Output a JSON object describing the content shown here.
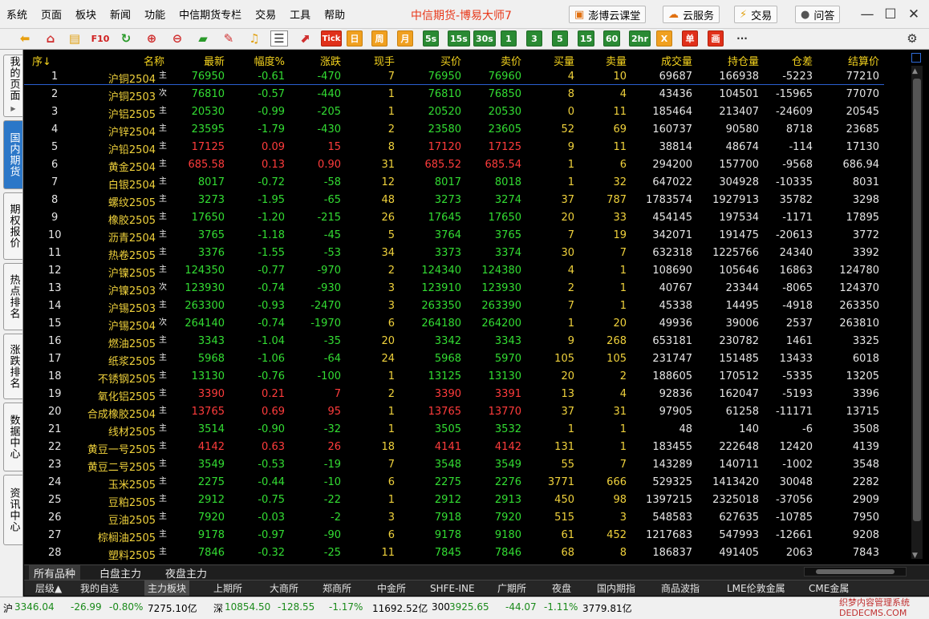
{
  "menu": [
    "系统",
    "页面",
    "板块",
    "新闻",
    "功能",
    "中信期货专栏",
    "交易",
    "工具",
    "帮助"
  ],
  "app_title": "中信期货-博易大师7",
  "top_buttons": [
    {
      "label": "澎博云课堂",
      "icon": "book-icon"
    },
    {
      "label": "云服务",
      "icon": "cloud-icon"
    },
    {
      "label": "交易",
      "icon": "lightning-icon"
    },
    {
      "label": "问答",
      "icon": "chat-icon"
    }
  ],
  "toolbar": {
    "f10": "F10",
    "tick": "Tick",
    "periods": [
      "日",
      "周",
      "月",
      "5s",
      "15s",
      "30s",
      "1",
      "3",
      "5",
      "15",
      "60",
      "2hr",
      "X",
      "单",
      "画"
    ],
    "more": "···"
  },
  "left_tabs": [
    "我的页面",
    "国内期货",
    "期权报价",
    "热点排名",
    "涨跌排名",
    "数据中心",
    "资讯中心"
  ],
  "headers": [
    "序↓",
    "名称",
    "最新",
    "幅度%",
    "涨跌",
    "现手",
    "买价",
    "卖价",
    "买量",
    "卖量",
    "成交量",
    "持仓量",
    "仓差",
    "结算价"
  ],
  "rows": [
    [
      "1",
      "沪铜2504",
      "主",
      "76950",
      "-0.61",
      "-470",
      "7",
      "76950",
      "76960",
      "4",
      "10",
      "69687",
      "166938",
      "-5223",
      "77210",
      "d"
    ],
    [
      "2",
      "沪铜2503",
      "次",
      "76810",
      "-0.57",
      "-440",
      "1",
      "76810",
      "76850",
      "8",
      "4",
      "43436",
      "104501",
      "-15965",
      "77070",
      "d"
    ],
    [
      "3",
      "沪铝2505",
      "主",
      "20530",
      "-0.99",
      "-205",
      "1",
      "20520",
      "20530",
      "0",
      "11",
      "185464",
      "213407",
      "-24609",
      "20545",
      "d"
    ],
    [
      "4",
      "沪锌2504",
      "主",
      "23595",
      "-1.79",
      "-430",
      "2",
      "23580",
      "23605",
      "52",
      "69",
      "160737",
      "90580",
      "8718",
      "23685",
      "d"
    ],
    [
      "5",
      "沪铅2504",
      "主",
      "17125",
      "0.09",
      "15",
      "8",
      "17120",
      "17125",
      "9",
      "11",
      "38814",
      "48674",
      "-114",
      "17130",
      "u"
    ],
    [
      "6",
      "黄金2504",
      "主",
      "685.58",
      "0.13",
      "0.90",
      "31",
      "685.52",
      "685.54",
      "1",
      "6",
      "294200",
      "157700",
      "-9568",
      "686.94",
      "u"
    ],
    [
      "7",
      "白银2504",
      "主",
      "8017",
      "-0.72",
      "-58",
      "12",
      "8017",
      "8018",
      "1",
      "32",
      "647022",
      "304928",
      "-10335",
      "8031",
      "d"
    ],
    [
      "8",
      "螺纹2505",
      "主",
      "3273",
      "-1.95",
      "-65",
      "48",
      "3273",
      "3274",
      "37",
      "787",
      "1783574",
      "1927913",
      "35782",
      "3298",
      "d"
    ],
    [
      "9",
      "橡胶2505",
      "主",
      "17650",
      "-1.20",
      "-215",
      "26",
      "17645",
      "17650",
      "20",
      "33",
      "454145",
      "197534",
      "-1171",
      "17895",
      "d"
    ],
    [
      "10",
      "沥青2504",
      "主",
      "3765",
      "-1.18",
      "-45",
      "5",
      "3764",
      "3765",
      "7",
      "19",
      "342071",
      "191475",
      "-20613",
      "3772",
      "d"
    ],
    [
      "11",
      "热卷2505",
      "主",
      "3376",
      "-1.55",
      "-53",
      "34",
      "3373",
      "3374",
      "30",
      "7",
      "632318",
      "1225766",
      "24340",
      "3392",
      "d"
    ],
    [
      "12",
      "沪镍2505",
      "主",
      "124350",
      "-0.77",
      "-970",
      "2",
      "124340",
      "124380",
      "4",
      "1",
      "108690",
      "105646",
      "16863",
      "124780",
      "d"
    ],
    [
      "13",
      "沪镍2503",
      "次",
      "123930",
      "-0.74",
      "-930",
      "3",
      "123910",
      "123930",
      "2",
      "1",
      "40767",
      "23344",
      "-8065",
      "124370",
      "d"
    ],
    [
      "14",
      "沪锡2503",
      "主",
      "263300",
      "-0.93",
      "-2470",
      "3",
      "263350",
      "263390",
      "7",
      "1",
      "45338",
      "14495",
      "-4918",
      "263350",
      "d"
    ],
    [
      "15",
      "沪锡2504",
      "次",
      "264140",
      "-0.74",
      "-1970",
      "6",
      "264180",
      "264200",
      "1",
      "20",
      "49936",
      "39006",
      "2537",
      "263810",
      "d"
    ],
    [
      "16",
      "燃油2505",
      "主",
      "3343",
      "-1.04",
      "-35",
      "20",
      "3342",
      "3343",
      "9",
      "268",
      "653181",
      "230782",
      "1461",
      "3325",
      "d"
    ],
    [
      "17",
      "纸浆2505",
      "主",
      "5968",
      "-1.06",
      "-64",
      "24",
      "5968",
      "5970",
      "105",
      "105",
      "231747",
      "151485",
      "13433",
      "6018",
      "d"
    ],
    [
      "18",
      "不锈钢2505",
      "主",
      "13130",
      "-0.76",
      "-100",
      "1",
      "13125",
      "13130",
      "20",
      "2",
      "188605",
      "170512",
      "-5335",
      "13205",
      "d"
    ],
    [
      "19",
      "氧化铝2505",
      "主",
      "3390",
      "0.21",
      "7",
      "2",
      "3390",
      "3391",
      "13",
      "4",
      "92836",
      "162047",
      "-5193",
      "3396",
      "u"
    ],
    [
      "20",
      "合成橡胶2504",
      "主",
      "13765",
      "0.69",
      "95",
      "1",
      "13765",
      "13770",
      "37",
      "31",
      "97905",
      "61258",
      "-11171",
      "13715",
      "u"
    ],
    [
      "21",
      "线材2505",
      "主",
      "3514",
      "-0.90",
      "-32",
      "1",
      "3505",
      "3532",
      "1",
      "1",
      "48",
      "140",
      "-6",
      "3508",
      "d"
    ],
    [
      "22",
      "黄豆一号2505",
      "主",
      "4142",
      "0.63",
      "26",
      "18",
      "4141",
      "4142",
      "131",
      "1",
      "183455",
      "222648",
      "12420",
      "4139",
      "u"
    ],
    [
      "23",
      "黄豆二号2505",
      "主",
      "3549",
      "-0.53",
      "-19",
      "7",
      "3548",
      "3549",
      "55",
      "7",
      "143289",
      "140711",
      "-1002",
      "3548",
      "d"
    ],
    [
      "24",
      "玉米2505",
      "主",
      "2275",
      "-0.44",
      "-10",
      "6",
      "2275",
      "2276",
      "3771",
      "666",
      "529325",
      "1413420",
      "30048",
      "2282",
      "d"
    ],
    [
      "25",
      "豆粕2505",
      "主",
      "2912",
      "-0.75",
      "-22",
      "1",
      "2912",
      "2913",
      "450",
      "98",
      "1397215",
      "2325018",
      "-37056",
      "2909",
      "d"
    ],
    [
      "26",
      "豆油2505",
      "主",
      "7920",
      "-0.03",
      "-2",
      "3",
      "7918",
      "7920",
      "515",
      "3",
      "548583",
      "627635",
      "-10785",
      "7950",
      "d"
    ],
    [
      "27",
      "棕榈油2505",
      "主",
      "9178",
      "-0.97",
      "-90",
      "6",
      "9178",
      "9180",
      "61",
      "452",
      "1217683",
      "547993",
      "-12661",
      "9208",
      "d"
    ],
    [
      "28",
      "塑料2505",
      "主",
      "7846",
      "-0.32",
      "-25",
      "11",
      "7845",
      "7846",
      "68",
      "8",
      "186837",
      "491405",
      "2063",
      "7843",
      "d"
    ]
  ],
  "bottom_tabs_1": [
    "所有品种",
    "白盘主力",
    "夜盘主力"
  ],
  "bottom_tabs_2": [
    "层级▲",
    "我的自选",
    "主力板块",
    "上期所",
    "大商所",
    "郑商所",
    "中金所",
    "SHFE-INE",
    "广期所",
    "夜盘",
    "国内期指",
    "商品波指",
    "LME伦敦金属",
    "CME金属"
  ],
  "status": [
    {
      "label": "沪",
      "value": "3346.04",
      "chg": "-26.99",
      "pct": "-0.80%",
      "amt": "7275.10亿"
    },
    {
      "label": "深",
      "value": "10854.50",
      "chg": "-128.55",
      "pct": "-1.17%",
      "amt": "11692.52亿"
    },
    {
      "label": "300",
      "value": "3925.65",
      "chg": "-44.07",
      "pct": "-1.11%",
      "amt": "3779.81亿"
    }
  ],
  "watermark": [
    "织梦内容管理系统",
    "DEDECMS.COM"
  ],
  "colors": {
    "up": "#ff3c3c",
    "down": "#33dd33",
    "header": "#f3d21e",
    "accent": "#2b77c8"
  }
}
